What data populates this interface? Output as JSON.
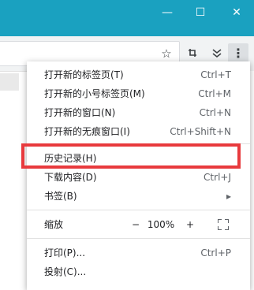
{
  "window_controls": {
    "minimize": "—",
    "maximize": "☐",
    "close": "✕"
  },
  "toolbar": {
    "icons": [
      "star-icon",
      "extension-icon",
      "double-chevron-icon",
      "menu-icon"
    ]
  },
  "menu": {
    "items": [
      {
        "label": "打开新的标签页(T)",
        "shortcut": "Ctrl+T"
      },
      {
        "label": "打开新的小号标签页(M)",
        "shortcut": "Ctrl+M"
      },
      {
        "label": "打开新的窗口(N)",
        "shortcut": "Ctrl+N"
      },
      {
        "label": "打开新的无痕窗口(I)",
        "shortcut": "Ctrl+Shift+N"
      },
      {
        "label": "历史记录(H)",
        "shortcut": ""
      },
      {
        "label": "下载内容(D)",
        "shortcut": "Ctrl+J"
      },
      {
        "label": "书签(B)",
        "shortcut": "▸"
      },
      {
        "label": "打印(P)...",
        "shortcut": "Ctrl+P"
      },
      {
        "label": "投射(C)...",
        "shortcut": ""
      }
    ],
    "zoom": {
      "label": "缩放",
      "minus": "−",
      "value": "100%",
      "plus": "+"
    }
  },
  "highlight_color": "#e83a3d",
  "titlebar_color": "#1aa1c0"
}
